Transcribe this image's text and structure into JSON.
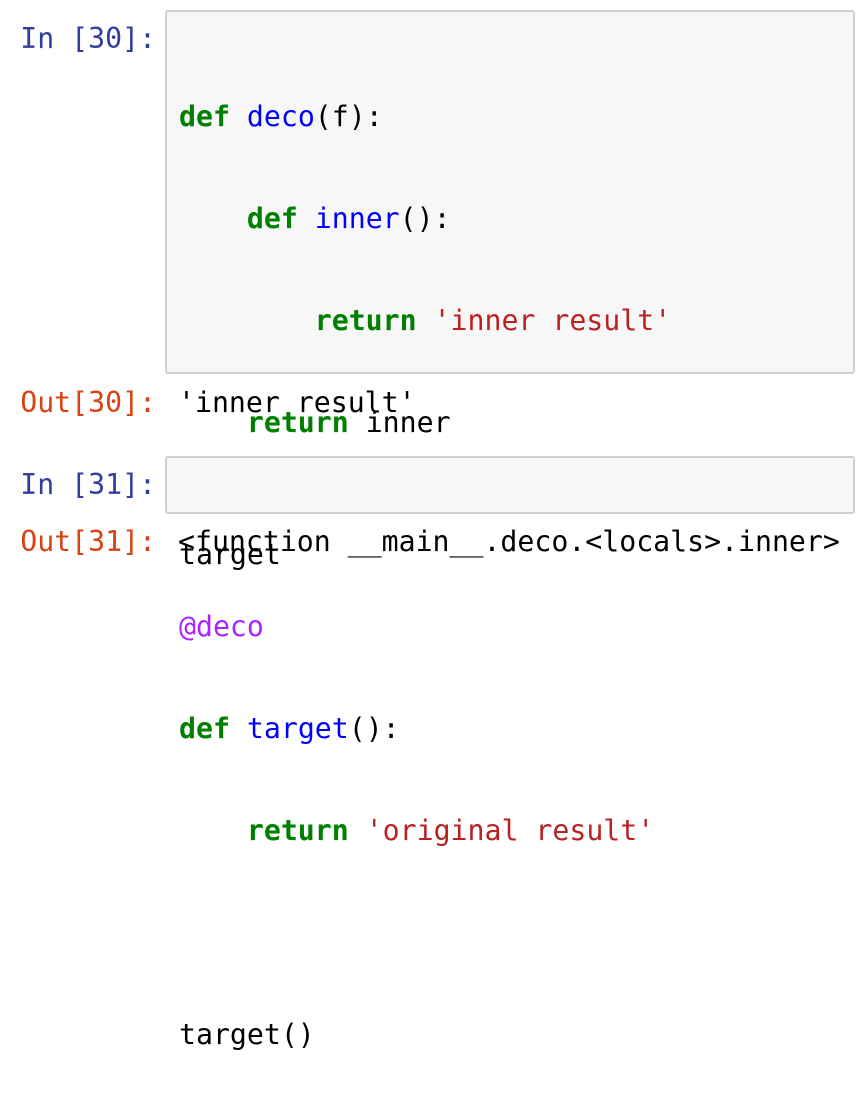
{
  "cells": [
    {
      "in_prompt": "In [30]:",
      "out_prompt": "Out[30]:",
      "code": {
        "l1": {
          "kw": "def",
          "sp": " ",
          "fn": "deco",
          "rest": "(f):"
        },
        "l2": {
          "indent": "    ",
          "kw": "def",
          "sp": " ",
          "fn": "inner",
          "rest": "():"
        },
        "l3": {
          "indent": "        ",
          "kw": "return",
          "sp": " ",
          "str": "'inner result'"
        },
        "l4": {
          "indent": "    ",
          "kw": "return",
          "rest": " inner"
        },
        "l6": {
          "dec": "@deco"
        },
        "l7": {
          "kw": "def",
          "sp": " ",
          "fn": "target",
          "rest": "():"
        },
        "l8": {
          "indent": "    ",
          "kw": "return",
          "sp": " ",
          "str": "'original result'"
        },
        "l10": {
          "rest": "target()"
        }
      },
      "output": "'inner result'"
    },
    {
      "in_prompt": "In [31]:",
      "out_prompt": "Out[31]:",
      "code": {
        "l1": {
          "rest": "target"
        }
      },
      "output": "<function __main__.deco.<locals>.inner>"
    }
  ],
  "colors": {
    "in_prompt": "#303f9f",
    "out_prompt": "#d84315",
    "keyword": "#008000",
    "function_name": "#0000ff",
    "string": "#ba2121",
    "decorator": "#aa22ff",
    "cell_background": "#f7f7f7",
    "cell_border": "#cfcfcf"
  }
}
